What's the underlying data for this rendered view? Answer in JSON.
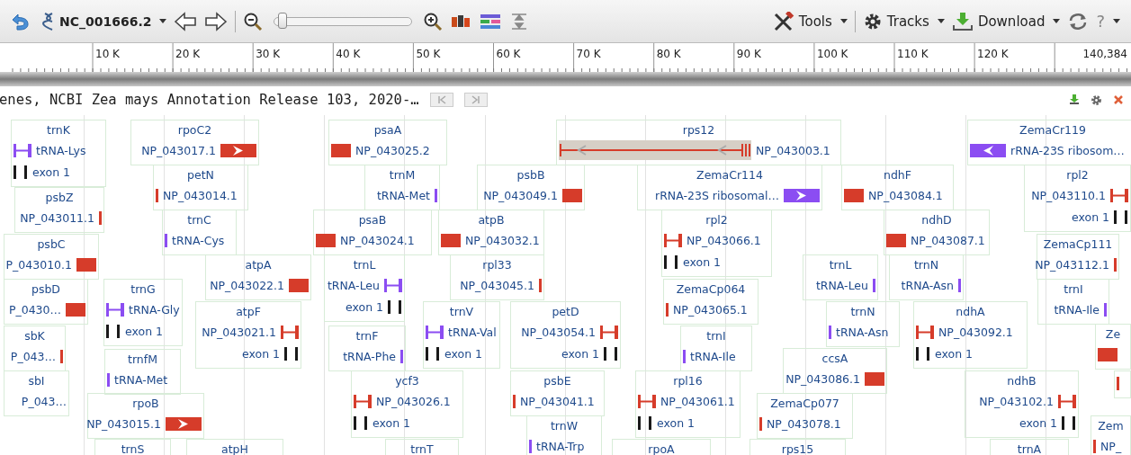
{
  "toolbar": {
    "sequence": "NC_001666.2",
    "zoom": {
      "level": 0.03
    },
    "menus": [
      {
        "label": "Tools"
      },
      {
        "label": "Tracks"
      },
      {
        "label": "Download"
      }
    ],
    "help": "?"
  },
  "ruler": {
    "ticks": [
      "10 K",
      "20 K",
      "30 K",
      "40 K",
      "50 K",
      "60 K",
      "70 K",
      "80 K",
      "90 K",
      "100 K",
      "110 K",
      "120 K"
    ],
    "end": "140,384"
  },
  "track": {
    "label": "enes, NCBI Zea mays Annotation Release 103, 2020-…",
    "features": [
      {
        "name": "trnK",
        "rows": [
          {
            "label": "tRNA-Lys",
            "kind": "split",
            "color": "#8b4df2"
          },
          {
            "label": "exon 1",
            "kind": "exons",
            "color": "#1a1a1a"
          }
        ]
      },
      {
        "name": "rpoC2",
        "rows": [
          {
            "label": "NP_043017.1",
            "kind": "arrow",
            "reverse": false,
            "color": "#d63c2a"
          }
        ]
      },
      {
        "name": "psaA",
        "rows": [
          {
            "label": "NP_043025.2",
            "kind": "block",
            "color": "#d63c2a"
          }
        ]
      },
      {
        "name": "rps12",
        "rows": [
          {
            "label": "NP_043003.1",
            "kind": "span",
            "color": "#d63c2a"
          }
        ]
      },
      {
        "name": "ZemaCr119",
        "rows": [
          {
            "label": "rRNA-23S ribosom…",
            "kind": "arrow",
            "reverse": true,
            "color": "#8b4df2"
          }
        ]
      },
      {
        "name": "psbZ",
        "rows": [
          {
            "label": "NP_043011.1",
            "kind": "thin",
            "color": "#d63c2a"
          }
        ]
      },
      {
        "name": "petN",
        "rows": [
          {
            "label": "NP_043014.1",
            "kind": "thin",
            "color": "#d63c2a"
          }
        ]
      },
      {
        "name": "trnM",
        "rows": [
          {
            "label": "tRNA-Met",
            "kind": "thin",
            "color": "#8b4df2"
          }
        ]
      },
      {
        "name": "psbB",
        "rows": [
          {
            "label": "NP_043049.1",
            "kind": "block",
            "color": "#d63c2a"
          }
        ]
      },
      {
        "name": "ZemaCr114",
        "rows": [
          {
            "label": "rRNA-23S ribosomal…",
            "kind": "arrow",
            "reverse": false,
            "color": "#8b4df2"
          }
        ]
      },
      {
        "name": "ndhF",
        "rows": [
          {
            "label": "NP_043084.1",
            "kind": "block",
            "color": "#d63c2a"
          }
        ]
      },
      {
        "name": "rpl2",
        "rows": [
          {
            "label": "NP_043110.1",
            "kind": "split",
            "color": "#d63c2a"
          },
          {
            "label": "exon 1",
            "kind": "exons",
            "color": "#1a1a1a"
          }
        ]
      },
      {
        "name": "trnC",
        "rows": [
          {
            "label": "tRNA-Cys",
            "kind": "thin",
            "color": "#8b4df2"
          }
        ]
      },
      {
        "name": "psaB",
        "rows": [
          {
            "label": "NP_043024.1",
            "kind": "block",
            "color": "#d63c2a"
          }
        ]
      },
      {
        "name": "atpB",
        "rows": [
          {
            "label": "NP_043032.1",
            "kind": "block",
            "color": "#d63c2a"
          }
        ]
      },
      {
        "name": "rpl2",
        "rows": [
          {
            "label": "NP_043066.1",
            "kind": "split",
            "color": "#d63c2a"
          },
          {
            "label": "exon 1",
            "kind": "exons",
            "color": "#1a1a1a"
          }
        ]
      },
      {
        "name": "ndhD",
        "rows": [
          {
            "label": "NP_043087.1",
            "kind": "block",
            "color": "#d63c2a"
          }
        ]
      },
      {
        "name": "psbC",
        "rows": [
          {
            "label": "P_043010.1",
            "kind": "block",
            "color": "#d63c2a"
          }
        ]
      },
      {
        "name": "ZemaCp111",
        "rows": [
          {
            "label": "NP_043112.1",
            "kind": "thin",
            "color": "#d63c2a"
          }
        ]
      },
      {
        "name": "atpA",
        "rows": [
          {
            "label": "NP_043022.1",
            "kind": "block",
            "color": "#d63c2a"
          }
        ]
      },
      {
        "name": "trnL",
        "rows": [
          {
            "label": "tRNA-Leu",
            "kind": "split",
            "color": "#8b4df2"
          },
          {
            "label": "exon 1",
            "kind": "exons",
            "color": "#1a1a1a"
          }
        ]
      },
      {
        "name": "rpl33",
        "rows": [
          {
            "label": "NP_043045.1",
            "kind": "thin",
            "color": "#d63c2a"
          }
        ]
      },
      {
        "name": "trnL",
        "rows": [
          {
            "label": "tRNA-Leu",
            "kind": "thin",
            "color": "#8b4df2"
          }
        ]
      },
      {
        "name": "trnN",
        "rows": [
          {
            "label": "tRNA-Asn",
            "kind": "thin",
            "color": "#8b4df2"
          }
        ]
      },
      {
        "name": "psbD",
        "rows": [
          {
            "label": "P_0430…",
            "kind": "block",
            "color": "#d63c2a"
          }
        ]
      },
      {
        "name": "trnG",
        "rows": [
          {
            "label": "tRNA-Gly",
            "kind": "split",
            "color": "#8b4df2"
          },
          {
            "label": "exon 1",
            "kind": "exons",
            "color": "#1a1a1a"
          }
        ]
      },
      {
        "name": "ZemaCp064",
        "rows": [
          {
            "label": "NP_043065.1",
            "kind": "thin",
            "color": "#d63c2a"
          }
        ]
      },
      {
        "name": "trnI",
        "rows": [
          {
            "label": "tRNA-Ile",
            "kind": "thin",
            "color": "#8b4df2"
          }
        ]
      },
      {
        "name": "sbK",
        "rows": [
          {
            "label": "P_043…",
            "kind": "thin",
            "color": "#d63c2a"
          }
        ]
      },
      {
        "name": "atpF",
        "rows": [
          {
            "label": "NP_043021.1",
            "kind": "split",
            "color": "#d63c2a"
          },
          {
            "label": "exon 1",
            "kind": "exons",
            "color": "#1a1a1a"
          }
        ]
      },
      {
        "name": "trnV",
        "rows": [
          {
            "label": "tRNA-Val",
            "kind": "split",
            "color": "#8b4df2"
          },
          {
            "label": "exon 1",
            "kind": "exons",
            "color": "#1a1a1a"
          }
        ]
      },
      {
        "name": "petD",
        "rows": [
          {
            "label": "NP_043054.1",
            "kind": "split",
            "color": "#d63c2a"
          },
          {
            "label": "exon 1",
            "kind": "exons",
            "color": "#1a1a1a"
          }
        ]
      },
      {
        "name": "trnN",
        "rows": [
          {
            "label": "tRNA-Asn",
            "kind": "thin",
            "color": "#8b4df2"
          }
        ]
      },
      {
        "name": "ndhA",
        "rows": [
          {
            "label": "NP_043092.1",
            "kind": "split",
            "color": "#d63c2a"
          },
          {
            "label": "exon 1",
            "kind": "exons",
            "color": "#1a1a1a"
          }
        ]
      },
      {
        "name": "Ze",
        "rows": [
          {
            "kind": "block",
            "color": "#d63c2a"
          }
        ]
      },
      {
        "name": "trnfM",
        "rows": [
          {
            "label": "tRNA-Met",
            "kind": "thin",
            "color": "#8b4df2"
          }
        ]
      },
      {
        "name": "trnF",
        "rows": [
          {
            "label": "tRNA-Phe",
            "kind": "thin",
            "color": "#8b4df2"
          }
        ]
      },
      {
        "name": "trnI",
        "rows": [
          {
            "label": "tRNA-Ile",
            "kind": "thin",
            "color": "#8b4df2"
          }
        ]
      },
      {
        "name": "ccsA",
        "rows": [
          {
            "label": "NP_043086.1",
            "kind": "block",
            "color": "#d63c2a"
          }
        ]
      },
      {
        "name": "sbI",
        "rows": [
          {
            "label": "P_043…",
            "kind": "none"
          }
        ]
      },
      {
        "name": "rpoB",
        "rows": [
          {
            "label": "NP_043015.1",
            "kind": "arrow",
            "reverse": false,
            "color": "#d63c2a"
          }
        ]
      },
      {
        "name": "ycf3",
        "rows": [
          {
            "label": "NP_043026.1",
            "kind": "split",
            "color": "#d63c2a"
          },
          {
            "label": "exon 1",
            "kind": "exons",
            "color": "#1a1a1a"
          }
        ]
      },
      {
        "name": "psbE",
        "rows": [
          {
            "label": "NP_043041.1",
            "kind": "thin",
            "color": "#d63c2a"
          }
        ]
      },
      {
        "name": "rpl16",
        "rows": [
          {
            "label": "NP_043061.1",
            "kind": "split",
            "color": "#d63c2a"
          },
          {
            "label": "exon 1",
            "kind": "exons",
            "color": "#1a1a1a"
          }
        ]
      },
      {
        "name": "ZemaCp077",
        "rows": [
          {
            "label": "NP_043078.1",
            "kind": "thin",
            "color": "#d63c2a"
          }
        ]
      },
      {
        "name": "ndhB",
        "rows": [
          {
            "label": "NP_043102.1",
            "kind": "split",
            "color": "#d63c2a"
          },
          {
            "label": "exon 1",
            "kind": "exons",
            "color": "#1a1a1a"
          }
        ]
      },
      {
        "rows": [
          {
            "kind": "thin",
            "color": "#d63c2a"
          }
        ]
      },
      {
        "name": "trnS"
      },
      {
        "name": "atpH"
      },
      {
        "name": "trnT"
      },
      {
        "name": "trnW",
        "rows": [
          {
            "label": "tRNA-Trp",
            "kind": "thin",
            "color": "#8b4df2"
          }
        ]
      },
      {
        "name": "rpoA"
      },
      {
        "name": "rps15"
      },
      {
        "name": "trnA"
      },
      {
        "name": "Zem",
        "rows": [
          {
            "label": "NP_",
            "kind": "thin",
            "color": "#d63c2a"
          }
        ]
      }
    ]
  }
}
